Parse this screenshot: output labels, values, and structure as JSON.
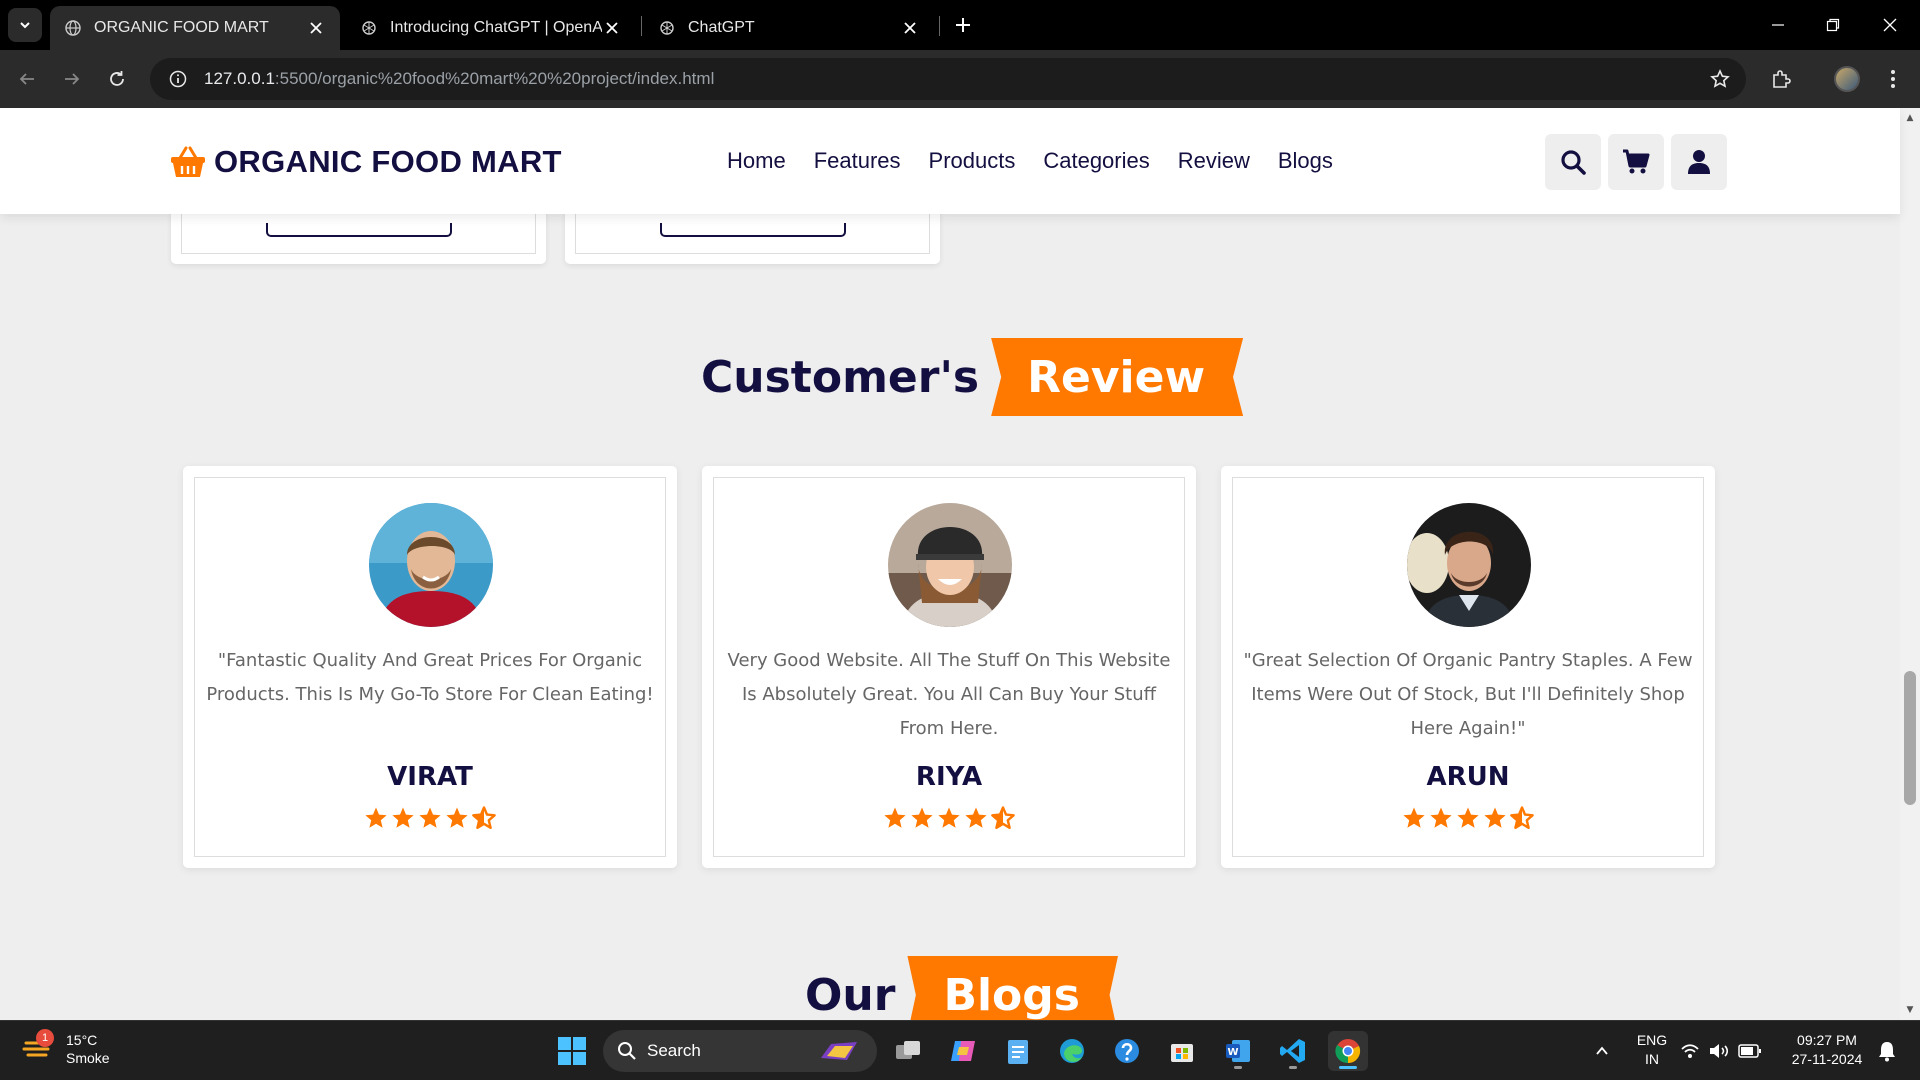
{
  "browser": {
    "tabs": [
      {
        "title": "ORGANIC FOOD MART",
        "active": true,
        "icon": "globe-icon"
      },
      {
        "title": "Introducing ChatGPT | OpenAI",
        "active": false,
        "icon": "openai-icon"
      },
      {
        "title": "ChatGPT",
        "active": false,
        "icon": "openai-icon"
      }
    ],
    "url_host": "127.0.0.1",
    "url_rest": ":5500/organic%20food%20mart%20%20project/index.html"
  },
  "header": {
    "brand": "ORGANIC FOOD MART",
    "nav": [
      "Home",
      "Features",
      "Products",
      "Categories",
      "Review",
      "Blogs"
    ],
    "buttons": [
      "search-icon",
      "cart-icon",
      "user-icon"
    ]
  },
  "review_section": {
    "heading_dark": "Customer's",
    "heading_ribbon": "Review",
    "reviews": [
      {
        "quote": "\"Fantastic Quality And Great Prices For Organic Products. This Is My Go-To Store For Clean Eating!",
        "name": "VIRAT",
        "rating": 4.5
      },
      {
        "quote": "Very Good Website. All The Stuff On This Website Is Absolutely Great. You All Can Buy Your Stuff From Here.",
        "name": "RIYA",
        "rating": 4.5
      },
      {
        "quote": "\"Great Selection Of Organic Pantry Staples. A Few Items Were Out Of Stock, But I'll Definitely Shop Here Again!\"",
        "name": "ARUN",
        "rating": 4.5
      }
    ]
  },
  "blogs_section": {
    "heading_dark": "Our",
    "heading_ribbon": "Blogs"
  },
  "taskbar": {
    "weather_temp": "15°C",
    "weather_desc": "Smoke",
    "weather_badge": "1",
    "search_label": "Search",
    "lang_top": "ENG",
    "lang_bottom": "IN",
    "time": "09:27 PM",
    "date": "27-11-2024"
  },
  "colors": {
    "accent": "#ff7800",
    "dark": "#130f40",
    "background": "#eeeeee"
  }
}
